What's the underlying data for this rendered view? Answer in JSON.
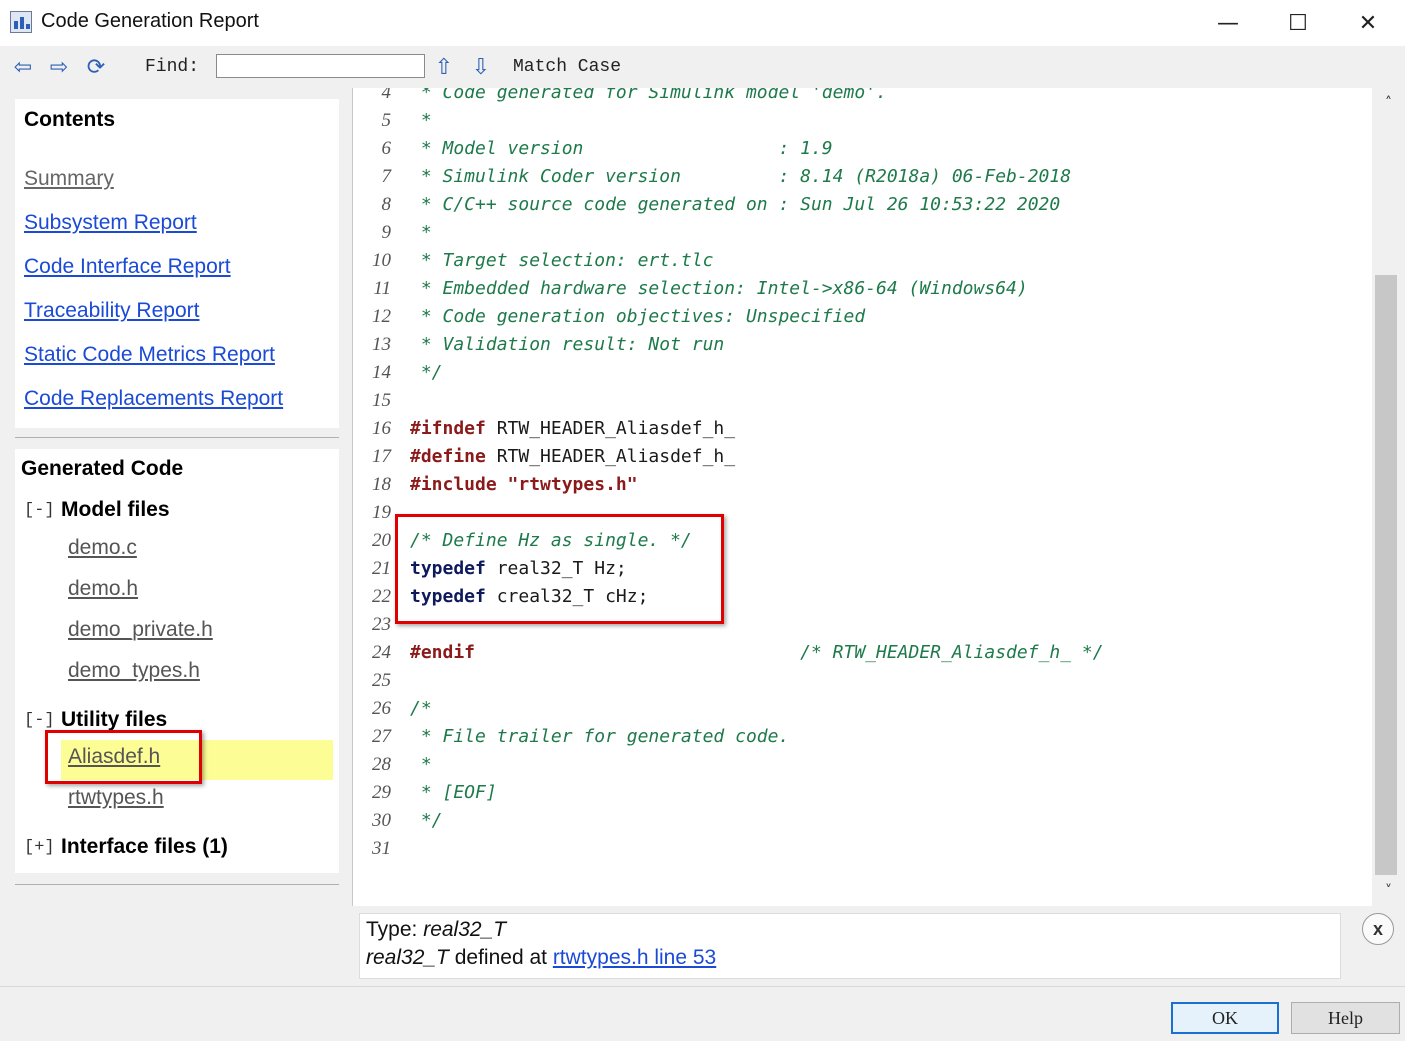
{
  "window": {
    "title": "Code Generation Report",
    "minimize_glyph": "—",
    "maximize_glyph": "☐",
    "close_glyph": "✕"
  },
  "toolbar": {
    "back_glyph": "⇦",
    "forward_glyph": "⇨",
    "refresh_glyph": "⟳",
    "find_label": "Find:",
    "find_value": "",
    "find_up_glyph": "⇧",
    "find_down_glyph": "⇩",
    "match_case_label": "Match Case"
  },
  "contents": {
    "title": "Contents",
    "links": [
      {
        "label": "Summary"
      },
      {
        "label": "Subsystem Report"
      },
      {
        "label": "Code Interface Report"
      },
      {
        "label": "Traceability Report"
      },
      {
        "label": "Static Code Metrics Report"
      },
      {
        "label": "Code Replacements Report"
      }
    ]
  },
  "generated_code": {
    "title": "Generated Code",
    "groups": [
      {
        "toggle": "[-]",
        "label": "Model files",
        "files": [
          "demo.c",
          "demo.h",
          "demo_private.h",
          "demo_types.h"
        ]
      },
      {
        "toggle": "[-]",
        "label": "Utility files",
        "files": [
          "Aliasdef.h",
          "rtwtypes.h"
        ],
        "selected": "Aliasdef.h"
      },
      {
        "toggle": "[+]",
        "label": "Interface files (1)",
        "files": []
      }
    ]
  },
  "code": {
    "lines": [
      {
        "n": "4",
        "t": " * Code generated for Simulink model 'demo'."
      },
      {
        "n": "5",
        "t": " *"
      },
      {
        "n": "6",
        "t": " * Model version                  : 1.9"
      },
      {
        "n": "7",
        "t": " * Simulink Coder version         : 8.14 (R2018a) 06-Feb-2018"
      },
      {
        "n": "8",
        "t": " * C/C++ source code generated on : Sun Jul 26 10:53:22 2020"
      },
      {
        "n": "9",
        "t": " *"
      },
      {
        "n": "10",
        "t": " * Target selection: ert.tlc"
      },
      {
        "n": "11",
        "t": " * Embedded hardware selection: Intel->x86-64 (Windows64)"
      },
      {
        "n": "12",
        "t": " * Code generation objectives: Unspecified"
      },
      {
        "n": "13",
        "t": " * Validation result: Not run"
      },
      {
        "n": "14",
        "t": " */"
      },
      {
        "n": "15",
        "t": ""
      },
      {
        "n": "16",
        "kw": "#ifndef",
        "rest": " RTW_HEADER_Aliasdef_h_"
      },
      {
        "n": "17",
        "kw": "#define",
        "rest": " RTW_HEADER_Aliasdef_h_"
      },
      {
        "n": "18",
        "kw": "#include",
        "str": " \"rtwtypes.h\""
      },
      {
        "n": "19",
        "t": ""
      },
      {
        "n": "20",
        "t": "/* Define Hz as single. */"
      },
      {
        "n": "21",
        "kwb": "typedef",
        "rest": " real32_T Hz;"
      },
      {
        "n": "22",
        "kwb": "typedef",
        "rest": " creal32_T cHz;"
      },
      {
        "n": "23",
        "t": ""
      },
      {
        "n": "24",
        "kw": "#endif",
        "rest": "                              ",
        "cmt": "/* RTW_HEADER_Aliasdef_h_ */"
      },
      {
        "n": "25",
        "t": ""
      },
      {
        "n": "26",
        "t": "/*"
      },
      {
        "n": "27",
        "t": " * File trailer for generated code."
      },
      {
        "n": "28",
        "t": " *"
      },
      {
        "n": "29",
        "t": " * [EOF]"
      },
      {
        "n": "30",
        "t": " */"
      },
      {
        "n": "31",
        "t": ""
      }
    ]
  },
  "info": {
    "type_prefix": "Type: ",
    "type_name": "real32_T",
    "defined_name": "real32_T",
    "defined_text": " defined at ",
    "defined_link": "rtwtypes.h line 53",
    "close_label": "x"
  },
  "buttons": {
    "ok": "OK",
    "help": "Help"
  },
  "scrollbar": {
    "up_glyph": "˄",
    "down_glyph": "˅"
  }
}
